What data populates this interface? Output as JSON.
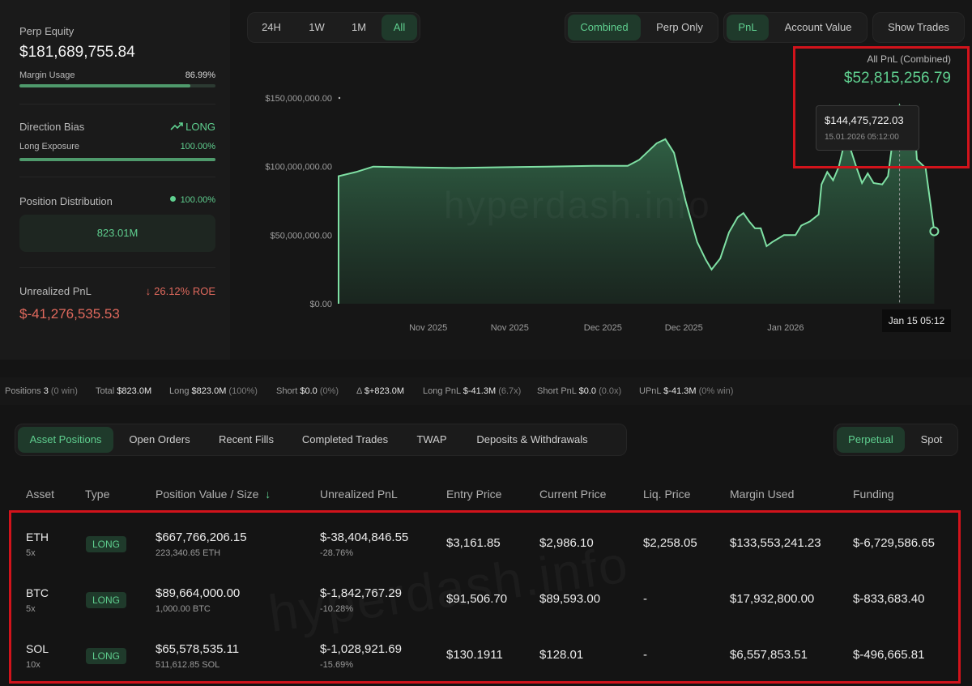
{
  "account": {
    "perp_equity_label": "Perp Equity",
    "perp_equity_value": "$181,689,755.84",
    "margin_usage_label": "Margin Usage",
    "margin_usage_value": "86.99%",
    "margin_usage_fraction": 0.8699,
    "direction_bias_label": "Direction Bias",
    "direction_bias_value": "LONG",
    "long_exposure_label": "Long Exposure",
    "long_exposure_value": "100.00%",
    "long_exposure_fraction": 1.0,
    "position_distribution_label": "Position Distribution",
    "position_distribution_pct": "100.00%",
    "position_distribution_value": "823.01M",
    "unrealized_pnl_label": "Unrealized PnL",
    "unrealized_roe": "26.12% ROE",
    "unrealized_pnl_value": "$-41,276,535.53"
  },
  "time_ranges": [
    "24H",
    "1W",
    "1M",
    "All"
  ],
  "view_modes": [
    "Combined",
    "Perp Only"
  ],
  "metrics": [
    "PnL",
    "Account Value"
  ],
  "show_trades_label": "Show Trades",
  "chart_header": {
    "title": "All PnL (Combined)",
    "value": "$52,815,256.79"
  },
  "tooltip": {
    "value": "$144,475,722.03",
    "timestamp": "15.01.2026 05:12:00"
  },
  "crosshair_label": "Jan 15 05:12",
  "watermark": "hyperdash.info",
  "chart_data": {
    "type": "area",
    "title": "All PnL (Combined)",
    "y_ticks": [
      "$0.00",
      "$50,000,000.00",
      "$100,000,000.00",
      "$150,000,000.00"
    ],
    "ylim": [
      0,
      150000000
    ],
    "x_tick_labels": [
      "Nov 2025",
      "Nov 2025",
      "Dec 2025",
      "Dec 2025",
      "Jan 2026"
    ],
    "x_ticks_t": [
      0.155,
      0.296,
      0.457,
      0.597,
      0.773
    ],
    "points": [
      [
        0.0,
        0
      ],
      [
        0.0,
        93000000
      ],
      [
        0.03,
        96000000
      ],
      [
        0.06,
        100000000
      ],
      [
        0.12,
        99500000
      ],
      [
        0.2,
        99000000
      ],
      [
        0.28,
        99500000
      ],
      [
        0.36,
        100000000
      ],
      [
        0.44,
        100500000
      ],
      [
        0.5,
        100500000
      ],
      [
        0.52,
        105000000
      ],
      [
        0.55,
        117000000
      ],
      [
        0.565,
        120000000
      ],
      [
        0.58,
        110000000
      ],
      [
        0.6,
        75000000
      ],
      [
        0.62,
        45000000
      ],
      [
        0.635,
        32000000
      ],
      [
        0.645,
        25000000
      ],
      [
        0.66,
        33000000
      ],
      [
        0.675,
        52000000
      ],
      [
        0.69,
        63000000
      ],
      [
        0.7,
        66000000
      ],
      [
        0.71,
        60000000
      ],
      [
        0.72,
        55000000
      ],
      [
        0.73,
        55000000
      ],
      [
        0.74,
        42000000
      ],
      [
        0.75,
        45000000
      ],
      [
        0.77,
        50000000
      ],
      [
        0.79,
        50000000
      ],
      [
        0.8,
        57000000
      ],
      [
        0.815,
        60000000
      ],
      [
        0.83,
        65000000
      ],
      [
        0.835,
        87000000
      ],
      [
        0.845,
        96000000
      ],
      [
        0.855,
        90000000
      ],
      [
        0.865,
        100000000
      ],
      [
        0.875,
        118000000
      ],
      [
        0.885,
        113000000
      ],
      [
        0.895,
        100000000
      ],
      [
        0.905,
        88000000
      ],
      [
        0.915,
        95000000
      ],
      [
        0.925,
        88000000
      ],
      [
        0.94,
        87000000
      ],
      [
        0.95,
        93000000
      ],
      [
        0.96,
        125000000
      ],
      [
        0.97,
        144475722
      ],
      [
        0.98,
        136000000
      ],
      [
        0.99,
        136000000
      ],
      [
        0.995,
        136500000
      ],
      [
        1.0,
        105000000
      ],
      [
        1.015,
        99000000
      ],
      [
        1.03,
        52815256
      ]
    ]
  },
  "stats": {
    "positions_label": "Positions",
    "positions_value": "3",
    "positions_note": "(0 win)",
    "total_label": "Total",
    "total_value": "$823.0M",
    "long_label": "Long",
    "long_value": "$823.0M",
    "long_note": "(100%)",
    "short_label": "Short",
    "short_value": "$0.0",
    "short_note": "(0%)",
    "delta_label": "Δ",
    "delta_value": "$+823.0M",
    "long_pnl_label": "Long PnL",
    "long_pnl_value": "$-41.3M",
    "long_pnl_note": "(6.7x)",
    "short_pnl_label": "Short PnL",
    "short_pnl_value": "$0.0",
    "short_pnl_note": "(0.0x)",
    "upnl_label": "UPnL",
    "upnl_value": "$-41.3M",
    "upnl_note": "(0% win)"
  },
  "tabs": [
    "Asset Positions",
    "Open Orders",
    "Recent Fills",
    "Completed Trades",
    "TWAP",
    "Deposits & Withdrawals"
  ],
  "market_toggle": [
    "Perpetual",
    "Spot"
  ],
  "table": {
    "headers": [
      "Asset",
      "Type",
      "Position Value / Size",
      "Unrealized PnL",
      "Entry Price",
      "Current Price",
      "Liq. Price",
      "Margin Used",
      "Funding"
    ],
    "sort_icon": "↓",
    "rows": [
      {
        "asset": "ETH",
        "leverage": "5x",
        "type": "LONG",
        "value": "$667,766,206.15",
        "size": "223,340.65 ETH",
        "pnl": "$-38,404,846.55",
        "pnl_pct": "-28.76%",
        "entry": "$3,161.85",
        "current": "$2,986.10",
        "liq": "$2,258.05",
        "margin": "$133,553,241.23",
        "funding": "$-6,729,586.65"
      },
      {
        "asset": "BTC",
        "leverage": "5x",
        "type": "LONG",
        "value": "$89,664,000.00",
        "size": "1,000.00 BTC",
        "pnl": "$-1,842,767.29",
        "pnl_pct": "-10.28%",
        "entry": "$91,506.70",
        "current": "$89,593.00",
        "liq": "-",
        "margin": "$17,932,800.00",
        "funding": "$-833,683.40"
      },
      {
        "asset": "SOL",
        "leverage": "10x",
        "type": "LONG",
        "value": "$65,578,535.11",
        "size": "511,612.85 SOL",
        "pnl": "$-1,028,921.69",
        "pnl_pct": "-15.69%",
        "entry": "$130.1911",
        "current": "$128.01",
        "liq": "-",
        "margin": "$6,557,853.51",
        "funding": "$-496,665.81"
      }
    ]
  },
  "colors": {
    "accent": "#5fcf8f",
    "negative": "#e0695d",
    "highlight": "#d2131b"
  }
}
